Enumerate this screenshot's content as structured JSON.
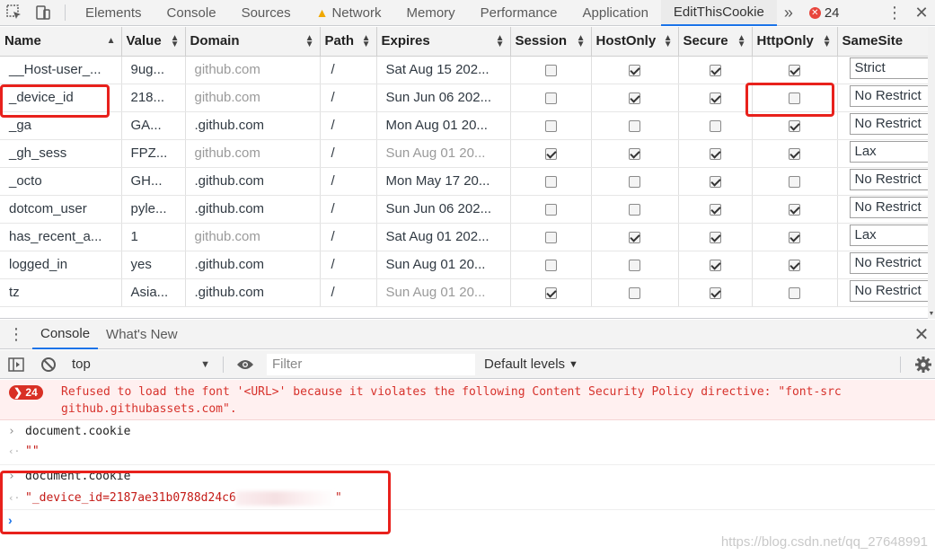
{
  "topbar": {
    "tabs": [
      "Elements",
      "Console",
      "Sources",
      "Network",
      "Memory",
      "Performance",
      "Application",
      "EditThisCookie"
    ],
    "active_tab": "EditThisCookie",
    "more_label": "»",
    "error_count": "24",
    "kebab": "⋮",
    "close": "✕"
  },
  "cookies": {
    "columns": [
      "Name",
      "Value",
      "Domain",
      "Path",
      "Expires",
      "Session",
      "HostOnly",
      "Secure",
      "HttpOnly",
      "SameSite"
    ],
    "sorted_column": "Name",
    "rows": [
      {
        "name": "__Host-user_...",
        "value": "9ug...",
        "domain": "github.com",
        "path": "/",
        "expires": "Sat Aug 15 202...",
        "session": false,
        "hostonly": true,
        "secure": true,
        "httponly": true,
        "samesite": "Strict"
      },
      {
        "name": "_device_id",
        "value": "218...",
        "domain": "github.com",
        "path": "/",
        "expires": "Sun Jun 06 202...",
        "session": false,
        "hostonly": true,
        "secure": true,
        "httponly": false,
        "samesite": "No Restrict"
      },
      {
        "name": "_ga",
        "value": "GA...",
        "domain": ".github.com",
        "path": "/",
        "expires": "Mon Aug 01 20...",
        "session": false,
        "hostonly": false,
        "secure": false,
        "httponly": true,
        "samesite": "No Restrict"
      },
      {
        "name": "_gh_sess",
        "value": "FPZ...",
        "domain": "github.com",
        "path": "/",
        "expires": "Sun Aug 01 20...",
        "session": true,
        "hostonly": true,
        "secure": true,
        "httponly": true,
        "samesite": "Lax"
      },
      {
        "name": "_octo",
        "value": "GH...",
        "domain": ".github.com",
        "path": "/",
        "expires": "Mon May 17 20...",
        "session": false,
        "hostonly": false,
        "secure": true,
        "httponly": false,
        "samesite": "No Restrict"
      },
      {
        "name": "dotcom_user",
        "value": "pyle...",
        "domain": ".github.com",
        "path": "/",
        "expires": "Sun Jun 06 202...",
        "session": false,
        "hostonly": false,
        "secure": true,
        "httponly": true,
        "samesite": "No Restrict"
      },
      {
        "name": "has_recent_a...",
        "value": "1",
        "domain": "github.com",
        "path": "/",
        "expires": "Sat Aug 01 202...",
        "session": false,
        "hostonly": true,
        "secure": true,
        "httponly": true,
        "samesite": "Lax"
      },
      {
        "name": "logged_in",
        "value": "yes",
        "domain": ".github.com",
        "path": "/",
        "expires": "Sun Aug 01 20...",
        "session": false,
        "hostonly": false,
        "secure": true,
        "httponly": true,
        "samesite": "No Restrict"
      },
      {
        "name": "tz",
        "value": "Asia...",
        "domain": ".github.com",
        "path": "/",
        "expires": "Sun Aug 01 20...",
        "session": true,
        "hostonly": false,
        "secure": true,
        "httponly": false,
        "samesite": "No Restrict"
      }
    ],
    "grey_domain_rows": [
      0,
      1,
      3,
      6
    ],
    "grey_expires_rows": [
      3,
      8
    ]
  },
  "drawer": {
    "tabs": [
      "Console",
      "What's New"
    ],
    "active_tab": "Console",
    "close": "✕"
  },
  "console_toolbar": {
    "context": "top",
    "filter_placeholder": "Filter",
    "levels_label": "Default levels"
  },
  "console": {
    "error_badge": "24",
    "error_line1": "Refused to load the font '<URL>' because it violates the following Content Security Policy directive: \"font-src",
    "error_line2": "github.githubassets.com\".",
    "cmd1": "document.cookie",
    "out1": "\"\"",
    "cmd2": "document.cookie",
    "out2_prefix": "\"_device_id=2187ae31b0788d24c6",
    "out2_suffix": "\""
  },
  "watermark": "https://blog.csdn.net/qq_27648991",
  "colors": {
    "annotation": "#e8211c",
    "accent": "#1a73e8",
    "error_text": "#d7322c"
  }
}
